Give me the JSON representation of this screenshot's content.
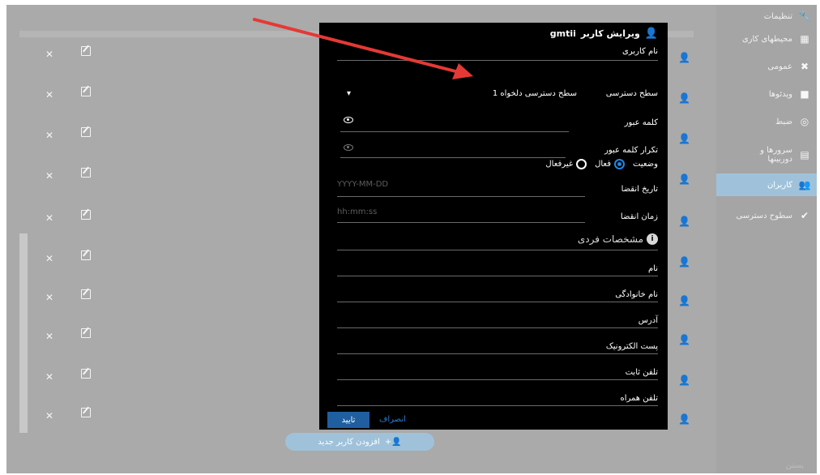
{
  "sidebar": {
    "items": [
      {
        "label": "تنظیمات",
        "icon": "wrench-icon"
      },
      {
        "label": "محیطهای کاری",
        "icon": "grid-icon"
      },
      {
        "label": "عمومی",
        "icon": "tools-icon"
      },
      {
        "label": "ویدئوها",
        "icon": "video-icon"
      },
      {
        "label": "ضبط",
        "icon": "record-icon"
      },
      {
        "label": "سرورها و دوربینها",
        "icon": "server-icon"
      },
      {
        "label": "کاربران",
        "icon": "users-icon",
        "active": true
      },
      {
        "label": "سطوح دسترسی",
        "icon": "check-circle-icon"
      }
    ],
    "footer": "بستن"
  },
  "list": {
    "rows": 10,
    "add_button": "افزودن کاربر جدید"
  },
  "modal": {
    "title_prefix": "ویرایش کاربر",
    "username": "gmtii",
    "fields": {
      "username_label": "نام کاربری",
      "access_label": "سطح دسترسی",
      "access_value": "سطح دسترسی دلخواه 1",
      "password_label": "کلمه عبور",
      "password_repeat_label": "تکرار کلمه عبور",
      "status_label": "وضعیت",
      "status_active": "فعال",
      "status_inactive": "غیرفعال",
      "expiry_date_label": "تاریخ انقضا",
      "expiry_date_placeholder": "YYYY-MM-DD",
      "expiry_time_label": "زمان انقضا",
      "expiry_time_placeholder": "hh:mm:ss",
      "personal_heading": "مشخصات فردی",
      "first_name_label": "نام",
      "last_name_label": "نام خانوادگی",
      "address_label": "آدرس",
      "email_label": "پست الکترونیک",
      "phone_label": "تلفن ثابت",
      "mobile_label": "تلفن همراه"
    },
    "confirm": "تایید",
    "cancel": "انصراف"
  },
  "colors": {
    "accent": "#1e88e5",
    "arrow": "#e53935",
    "sidebar_active": "#9fc2da",
    "user_icon": "#7fcf8f"
  }
}
